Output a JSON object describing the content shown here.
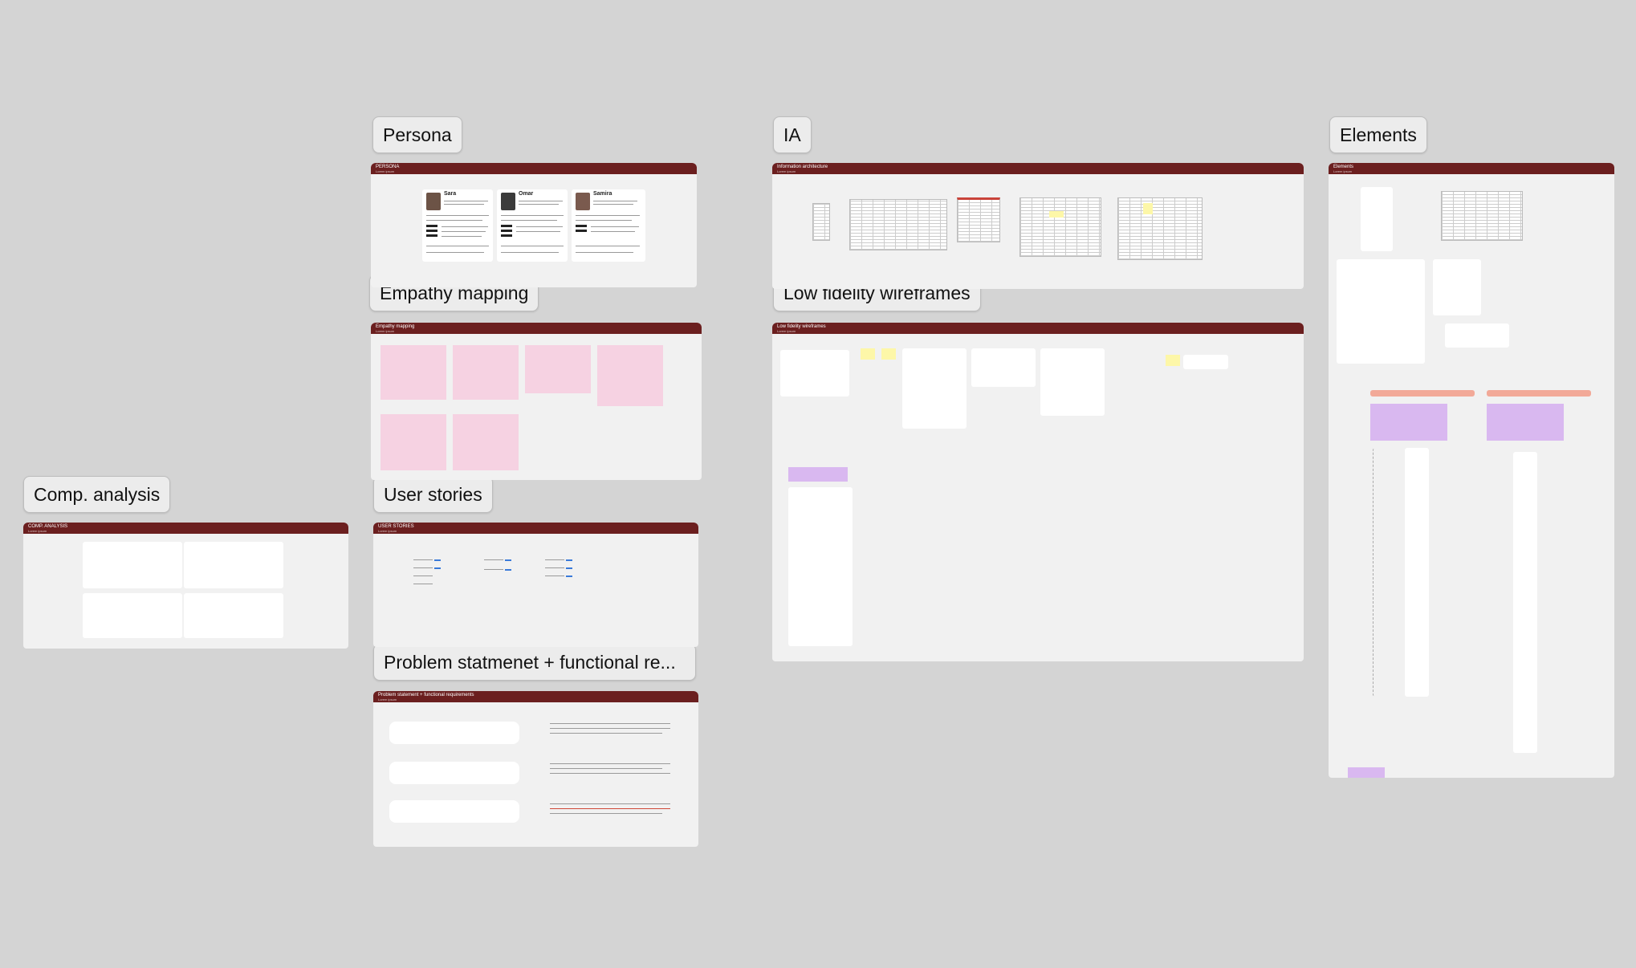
{
  "labels": {
    "persona": "Persona",
    "ia": "IA",
    "elements": "Elements",
    "empathy": "Empathy mapping",
    "lowfi": "Low fidelity wireframes",
    "comp": "Comp. analysis",
    "stories": "User stories",
    "problem": "Problem statmenet + functional re..."
  },
  "frames": {
    "persona": {
      "title": "PERSONA",
      "sub": "Lorem ipsum"
    },
    "ia": {
      "title": "Information architecture",
      "sub": "Lorem ipsum"
    },
    "elements": {
      "title": "Elements",
      "sub": "Lorem ipsum"
    },
    "empathy": {
      "title": "Empathy mapping",
      "sub": "Lorem ipsum"
    },
    "lowfi": {
      "title": "Low fidelity wireframes",
      "sub": "Lorem ipsum"
    },
    "comp": {
      "title": "COMP. ANALYSIS",
      "sub": "Lorem ipsum"
    },
    "stories": {
      "title": "USER STORIES",
      "sub": "Lorem ipsum"
    },
    "problem": {
      "title": "Problem statement + functional requirements",
      "sub": "Lorem ipsum"
    }
  },
  "personas": [
    "Sara",
    "Omar",
    "Samira"
  ],
  "colors": {
    "canvas": "#d4d4d4",
    "frame_header": "#6b1f1f",
    "frame_body": "#f1f1f1",
    "sticky_pink": "#f6d2e2",
    "sticky_purple": "#d9b8f0",
    "sticky_yellow": "#fdf7a8"
  }
}
